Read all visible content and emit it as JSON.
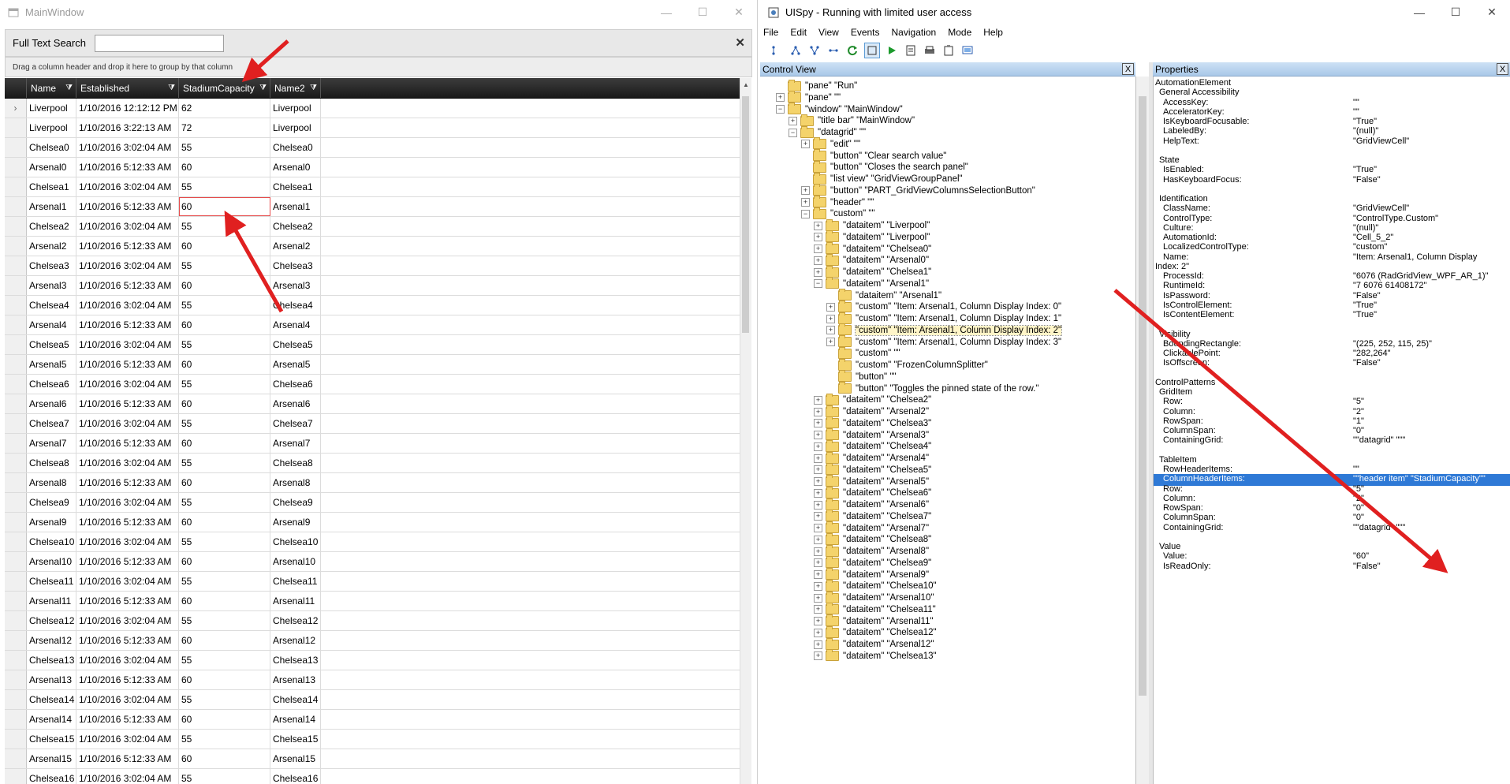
{
  "main_window": {
    "title": "MainWindow",
    "controls": {
      "minimize": "—",
      "maximize": "☐",
      "close": "✕"
    },
    "search": {
      "label": "Full Text Search",
      "value": "",
      "clear": "✕"
    },
    "group_hint": "Drag a column header and drop it here to group by that column",
    "columns": [
      "Name",
      "Established",
      "StadiumCapacity",
      "Name2"
    ],
    "current_row_marker": "›",
    "rows": [
      [
        "Liverpool",
        "1/10/2016 12:12:12 PM",
        "62",
        "Liverpool"
      ],
      [
        "Liverpool",
        "1/10/2016 3:22:13 AM",
        "72",
        "Liverpool"
      ],
      [
        "Chelsea0",
        "1/10/2016 3:02:04 AM",
        "55",
        "Chelsea0"
      ],
      [
        "Arsenal0",
        "1/10/2016 5:12:33 AM",
        "60",
        "Arsenal0"
      ],
      [
        "Chelsea1",
        "1/10/2016 3:02:04 AM",
        "55",
        "Chelsea1"
      ],
      [
        "Arsenal1",
        "1/10/2016 5:12:33 AM",
        "60",
        "Arsenal1"
      ],
      [
        "Chelsea2",
        "1/10/2016 3:02:04 AM",
        "55",
        "Chelsea2"
      ],
      [
        "Arsenal2",
        "1/10/2016 5:12:33 AM",
        "60",
        "Arsenal2"
      ],
      [
        "Chelsea3",
        "1/10/2016 3:02:04 AM",
        "55",
        "Chelsea3"
      ],
      [
        "Arsenal3",
        "1/10/2016 5:12:33 AM",
        "60",
        "Arsenal3"
      ],
      [
        "Chelsea4",
        "1/10/2016 3:02:04 AM",
        "55",
        "Chelsea4"
      ],
      [
        "Arsenal4",
        "1/10/2016 5:12:33 AM",
        "60",
        "Arsenal4"
      ],
      [
        "Chelsea5",
        "1/10/2016 3:02:04 AM",
        "55",
        "Chelsea5"
      ],
      [
        "Arsenal5",
        "1/10/2016 5:12:33 AM",
        "60",
        "Arsenal5"
      ],
      [
        "Chelsea6",
        "1/10/2016 3:02:04 AM",
        "55",
        "Chelsea6"
      ],
      [
        "Arsenal6",
        "1/10/2016 5:12:33 AM",
        "60",
        "Arsenal6"
      ],
      [
        "Chelsea7",
        "1/10/2016 3:02:04 AM",
        "55",
        "Chelsea7"
      ],
      [
        "Arsenal7",
        "1/10/2016 5:12:33 AM",
        "60",
        "Arsenal7"
      ],
      [
        "Chelsea8",
        "1/10/2016 3:02:04 AM",
        "55",
        "Chelsea8"
      ],
      [
        "Arsenal8",
        "1/10/2016 5:12:33 AM",
        "60",
        "Arsenal8"
      ],
      [
        "Chelsea9",
        "1/10/2016 3:02:04 AM",
        "55",
        "Chelsea9"
      ],
      [
        "Arsenal9",
        "1/10/2016 5:12:33 AM",
        "60",
        "Arsenal9"
      ],
      [
        "Chelsea10",
        "1/10/2016 3:02:04 AM",
        "55",
        "Chelsea10"
      ],
      [
        "Arsenal10",
        "1/10/2016 5:12:33 AM",
        "60",
        "Arsenal10"
      ],
      [
        "Chelsea11",
        "1/10/2016 3:02:04 AM",
        "55",
        "Chelsea11"
      ],
      [
        "Arsenal11",
        "1/10/2016 5:12:33 AM",
        "60",
        "Arsenal11"
      ],
      [
        "Chelsea12",
        "1/10/2016 3:02:04 AM",
        "55",
        "Chelsea12"
      ],
      [
        "Arsenal12",
        "1/10/2016 5:12:33 AM",
        "60",
        "Arsenal12"
      ],
      [
        "Chelsea13",
        "1/10/2016 3:02:04 AM",
        "55",
        "Chelsea13"
      ],
      [
        "Arsenal13",
        "1/10/2016 5:12:33 AM",
        "60",
        "Arsenal13"
      ],
      [
        "Chelsea14",
        "1/10/2016 3:02:04 AM",
        "55",
        "Chelsea14"
      ],
      [
        "Arsenal14",
        "1/10/2016 5:12:33 AM",
        "60",
        "Arsenal14"
      ],
      [
        "Chelsea15",
        "1/10/2016 3:02:04 AM",
        "55",
        "Chelsea15"
      ],
      [
        "Arsenal15",
        "1/10/2016 5:12:33 AM",
        "60",
        "Arsenal15"
      ],
      [
        "Chelsea16",
        "1/10/2016 3:02:04 AM",
        "55",
        "Chelsea16"
      ]
    ],
    "current_row_index": 0,
    "selected_row_index": 5,
    "selected_column_index": 2
  },
  "uispy": {
    "title": "UISpy - Running with limited user access",
    "controls": {
      "minimize": "—",
      "maximize": "☐",
      "close": "✕"
    },
    "menu": [
      "File",
      "Edit",
      "View",
      "Events",
      "Navigation",
      "Mode",
      "Help"
    ],
    "toolbar_icons": [
      "tree-view-icon",
      "tree-nodes-icon",
      "tree-children-icon",
      "tree-parent-icon",
      "refresh-icon",
      "highlight-icon",
      "play-icon",
      "report-icon",
      "print-icon",
      "clipboard-icon",
      "screenshot-icon"
    ],
    "control_view": {
      "title": "Control View",
      "close": "X",
      "nodes": [
        {
          "level": 1,
          "exp": "",
          "label": "\"pane\" \"Run\""
        },
        {
          "level": 1,
          "exp": "+",
          "label": "\"pane\" \"\""
        },
        {
          "level": 1,
          "exp": "-",
          "label": "\"window\" \"MainWindow\""
        },
        {
          "level": 2,
          "exp": "+",
          "label": "\"title bar\" \"MainWindow\""
        },
        {
          "level": 2,
          "exp": "-",
          "label": "\"datagrid\" \"\""
        },
        {
          "level": 3,
          "exp": "+",
          "label": "\"edit\" \"\""
        },
        {
          "level": 3,
          "exp": "",
          "label": "\"button\" \"Clear search value\""
        },
        {
          "level": 3,
          "exp": "",
          "label": "\"button\" \"Closes the search panel\""
        },
        {
          "level": 3,
          "exp": "",
          "label": "\"list view\" \"GridViewGroupPanel\""
        },
        {
          "level": 3,
          "exp": "+",
          "label": "\"button\" \"PART_GridViewColumnsSelectionButton\""
        },
        {
          "level": 3,
          "exp": "+",
          "label": "\"header\" \"\""
        },
        {
          "level": 3,
          "exp": "-",
          "label": "\"custom\" \"\""
        },
        {
          "level": 4,
          "exp": "+",
          "label": "\"dataitem\" \"Liverpool\""
        },
        {
          "level": 4,
          "exp": "+",
          "label": "\"dataitem\" \"Liverpool\""
        },
        {
          "level": 4,
          "exp": "+",
          "label": "\"dataitem\" \"Chelsea0\""
        },
        {
          "level": 4,
          "exp": "+",
          "label": "\"dataitem\" \"Arsenal0\""
        },
        {
          "level": 4,
          "exp": "+",
          "label": "\"dataitem\" \"Chelsea1\""
        },
        {
          "level": 4,
          "exp": "-",
          "label": "\"dataitem\" \"Arsenal1\""
        },
        {
          "level": 5,
          "exp": "",
          "label": "\"dataitem\" \"Arsenal1\""
        },
        {
          "level": 5,
          "exp": "+",
          "label": "\"custom\" \"Item: Arsenal1, Column Display Index: 0\""
        },
        {
          "level": 5,
          "exp": "+",
          "label": "\"custom\" \"Item: Arsenal1, Column Display Index: 1\""
        },
        {
          "level": 5,
          "exp": "+",
          "label": "\"custom\" \"Item: Arsenal1, Column Display Index: 2\"",
          "hl": true
        },
        {
          "level": 5,
          "exp": "+",
          "label": "\"custom\" \"Item: Arsenal1, Column Display Index: 3\""
        },
        {
          "level": 5,
          "exp": "",
          "label": "\"custom\" \"\""
        },
        {
          "level": 5,
          "exp": "",
          "label": "\"custom\" \"FrozenColumnSplitter\""
        },
        {
          "level": 5,
          "exp": "",
          "label": "\"button\" \"\""
        },
        {
          "level": 5,
          "exp": "",
          "label": "\"button\" \"Toggles the pinned state of the row.\""
        },
        {
          "level": 4,
          "exp": "+",
          "label": "\"dataitem\" \"Chelsea2\""
        },
        {
          "level": 4,
          "exp": "+",
          "label": "\"dataitem\" \"Arsenal2\""
        },
        {
          "level": 4,
          "exp": "+",
          "label": "\"dataitem\" \"Chelsea3\""
        },
        {
          "level": 4,
          "exp": "+",
          "label": "\"dataitem\" \"Arsenal3\""
        },
        {
          "level": 4,
          "exp": "+",
          "label": "\"dataitem\" \"Chelsea4\""
        },
        {
          "level": 4,
          "exp": "+",
          "label": "\"dataitem\" \"Arsenal4\""
        },
        {
          "level": 4,
          "exp": "+",
          "label": "\"dataitem\" \"Chelsea5\""
        },
        {
          "level": 4,
          "exp": "+",
          "label": "\"dataitem\" \"Arsenal5\""
        },
        {
          "level": 4,
          "exp": "+",
          "label": "\"dataitem\" \"Chelsea6\""
        },
        {
          "level": 4,
          "exp": "+",
          "label": "\"dataitem\" \"Arsenal6\""
        },
        {
          "level": 4,
          "exp": "+",
          "label": "\"dataitem\" \"Chelsea7\""
        },
        {
          "level": 4,
          "exp": "+",
          "label": "\"dataitem\" \"Arsenal7\""
        },
        {
          "level": 4,
          "exp": "+",
          "label": "\"dataitem\" \"Chelsea8\""
        },
        {
          "level": 4,
          "exp": "+",
          "label": "\"dataitem\" \"Arsenal8\""
        },
        {
          "level": 4,
          "exp": "+",
          "label": "\"dataitem\" \"Chelsea9\""
        },
        {
          "level": 4,
          "exp": "+",
          "label": "\"dataitem\" \"Arsenal9\""
        },
        {
          "level": 4,
          "exp": "+",
          "label": "\"dataitem\" \"Chelsea10\""
        },
        {
          "level": 4,
          "exp": "+",
          "label": "\"dataitem\" \"Arsenal10\""
        },
        {
          "level": 4,
          "exp": "+",
          "label": "\"dataitem\" \"Chelsea11\""
        },
        {
          "level": 4,
          "exp": "+",
          "label": "\"dataitem\" \"Arsenal11\""
        },
        {
          "level": 4,
          "exp": "+",
          "label": "\"dataitem\" \"Chelsea12\""
        },
        {
          "level": 4,
          "exp": "+",
          "label": "\"dataitem\" \"Arsenal12\""
        },
        {
          "level": 4,
          "exp": "+",
          "label": "\"dataitem\" \"Chelsea13\""
        }
      ]
    },
    "properties": {
      "title": "Properties",
      "close": "X",
      "lines": [
        {
          "k": "AutomationElement",
          "v": "",
          "ind": 0
        },
        {
          "k": "General Accessibility",
          "v": "",
          "ind": 1
        },
        {
          "k": "AccessKey:",
          "v": "\"\"",
          "ind": 2
        },
        {
          "k": "AcceleratorKey:",
          "v": "\"\"",
          "ind": 2
        },
        {
          "k": "IsKeyboardFocusable:",
          "v": "\"True\"",
          "ind": 2
        },
        {
          "k": "LabeledBy:",
          "v": "\"(null)\"",
          "ind": 2
        },
        {
          "k": "HelpText:",
          "v": "\"GridViewCell\"",
          "ind": 2
        },
        {
          "k": "",
          "v": "",
          "ind": 0
        },
        {
          "k": "State",
          "v": "",
          "ind": 1
        },
        {
          "k": "IsEnabled:",
          "v": "\"True\"",
          "ind": 2
        },
        {
          "k": "HasKeyboardFocus:",
          "v": "\"False\"",
          "ind": 2
        },
        {
          "k": "",
          "v": "",
          "ind": 0
        },
        {
          "k": "Identification",
          "v": "",
          "ind": 1
        },
        {
          "k": "ClassName:",
          "v": "\"GridViewCell\"",
          "ind": 2
        },
        {
          "k": "ControlType:",
          "v": "\"ControlType.Custom\"",
          "ind": 2
        },
        {
          "k": "Culture:",
          "v": "\"(null)\"",
          "ind": 2
        },
        {
          "k": "AutomationId:",
          "v": "\"Cell_5_2\"",
          "ind": 2
        },
        {
          "k": "LocalizedControlType:",
          "v": "\"custom\"",
          "ind": 2
        },
        {
          "k": "Name:",
          "v": "\"Item: Arsenal1, Column Display",
          "ind": 2
        },
        {
          "k": "Index: 2\"",
          "v": "",
          "ind": 0
        },
        {
          "k": "ProcessId:",
          "v": "\"6076 (RadGridView_WPF_AR_1)\"",
          "ind": 2
        },
        {
          "k": "RuntimeId:",
          "v": "\"7 6076 61408172\"",
          "ind": 2
        },
        {
          "k": "IsPassword:",
          "v": "\"False\"",
          "ind": 2
        },
        {
          "k": "IsControlElement:",
          "v": "\"True\"",
          "ind": 2
        },
        {
          "k": "IsContentElement:",
          "v": "\"True\"",
          "ind": 2
        },
        {
          "k": "",
          "v": "",
          "ind": 0
        },
        {
          "k": "Visibility",
          "v": "",
          "ind": 1
        },
        {
          "k": "BoundingRectangle:",
          "v": "\"(225, 252, 115, 25)\"",
          "ind": 2
        },
        {
          "k": "ClickablePoint:",
          "v": "\"282,264\"",
          "ind": 2
        },
        {
          "k": "IsOffscreen:",
          "v": "\"False\"",
          "ind": 2
        },
        {
          "k": "",
          "v": "",
          "ind": 0
        },
        {
          "k": "ControlPatterns",
          "v": "",
          "ind": 0
        },
        {
          "k": "GridItem",
          "v": "",
          "ind": 1
        },
        {
          "k": "Row:",
          "v": "\"5\"",
          "ind": 2
        },
        {
          "k": "Column:",
          "v": "\"2\"",
          "ind": 2
        },
        {
          "k": "RowSpan:",
          "v": "\"1\"",
          "ind": 2
        },
        {
          "k": "ColumnSpan:",
          "v": "\"0\"",
          "ind": 2
        },
        {
          "k": "ContainingGrid:",
          "v": "\"\"datagrid\" \"\"\"",
          "ind": 2
        },
        {
          "k": "",
          "v": "",
          "ind": 0
        },
        {
          "k": "TableItem",
          "v": "",
          "ind": 1
        },
        {
          "k": "RowHeaderItems:",
          "v": "\"\"",
          "ind": 2
        },
        {
          "k": "ColumnHeaderItems:",
          "v": "\"\"header item\" \"StadiumCapacity\"\"",
          "ind": 2,
          "sel": true
        },
        {
          "k": "Row:",
          "v": "\"5\"",
          "ind": 2
        },
        {
          "k": "Column:",
          "v": "\"2\"",
          "ind": 2
        },
        {
          "k": "RowSpan:",
          "v": "\"0\"",
          "ind": 2
        },
        {
          "k": "ColumnSpan:",
          "v": "\"0\"",
          "ind": 2
        },
        {
          "k": "ContainingGrid:",
          "v": "\"\"datagrid\" \"\"\"",
          "ind": 2
        },
        {
          "k": "",
          "v": "",
          "ind": 0
        },
        {
          "k": "Value",
          "v": "",
          "ind": 1
        },
        {
          "k": "Value:",
          "v": "\"60\"",
          "ind": 2
        },
        {
          "k": "IsReadOnly:",
          "v": "\"False\"",
          "ind": 2
        }
      ]
    }
  },
  "colors": {
    "arrow": "#e02020",
    "selection": "#2e79d6",
    "header_bg": "#222222"
  }
}
